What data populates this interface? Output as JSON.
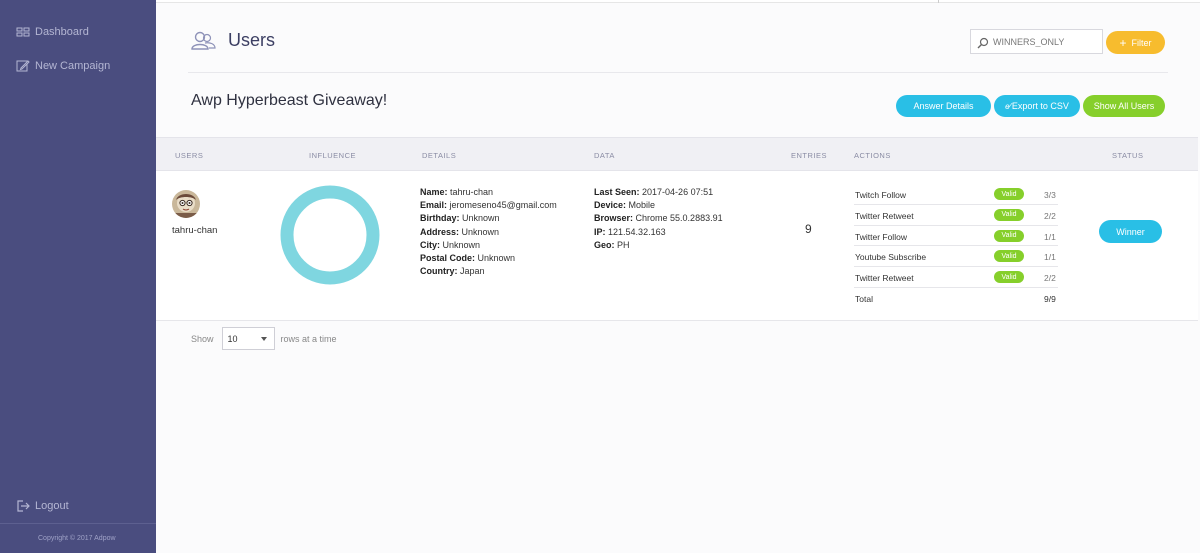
{
  "sidebar": {
    "items": [
      {
        "label": "Dashboard",
        "icon": "dashboard-icon"
      },
      {
        "label": "New Campaign",
        "icon": "edit-icon"
      }
    ],
    "logout": "Logout",
    "copyright": "Copyright © 2017 Adpow"
  },
  "header": {
    "title": "Users",
    "search_value": "WINNERS_ONLY",
    "filter_label": "Filter"
  },
  "campaign": {
    "title": "Awp Hyperbeast Giveaway!",
    "buttons": {
      "answer_details": "Answer Details",
      "export_csv": "Export to CSV",
      "show_all": "Show All Users"
    }
  },
  "table": {
    "columns": [
      "USERS",
      "INFLUENCE",
      "DETAILS",
      "DATA",
      "ENTRIES",
      "ACTIONS",
      "STATUS"
    ],
    "row": {
      "username": "tahru-chan",
      "details": {
        "name": "tahru-chan",
        "email": "jeromeseno45@gmail.com",
        "birthday": "Unknown",
        "address": "Unknown",
        "city": "Unknown",
        "postal_code": "Unknown",
        "country": "Japan"
      },
      "data": {
        "last_seen": "2017-04-26 07:51",
        "device": "Mobile",
        "browser": "Chrome 55.0.2883.91",
        "ip": "121.54.32.163",
        "geo": "PH"
      },
      "entries": "9",
      "actions": [
        {
          "name": "Twitch Follow",
          "status": "Valid",
          "count": "3/3"
        },
        {
          "name": "Twitter Retweet",
          "status": "Valid",
          "count": "2/2"
        },
        {
          "name": "Twitter Follow",
          "status": "Valid",
          "count": "1/1"
        },
        {
          "name": "Youtube Subscribe",
          "status": "Valid",
          "count": "1/1"
        },
        {
          "name": "Twitter Retweet",
          "status": "Valid",
          "count": "2/2"
        }
      ],
      "total_label": "Total",
      "total_count": "9/9",
      "status": "Winner"
    }
  },
  "labels": {
    "name": "Name:",
    "email": "Email:",
    "birthday": "Birthday:",
    "address": "Address:",
    "city": "City:",
    "postal_code": "Postal Code:",
    "country": "Country:",
    "last_seen": "Last Seen:",
    "device": "Device:",
    "browser": "Browser:",
    "ip": "IP:",
    "geo": "Geo:"
  },
  "pager": {
    "show": "Show",
    "rows_value": "10",
    "suffix": "rows at a time"
  },
  "colors": {
    "sidebar": "#4a4d7f",
    "accent_blue": "#29bfe6",
    "accent_green": "#86cf2b",
    "accent_yellow": "#f7bc2e",
    "influence_ring": "#7fd6e0"
  }
}
